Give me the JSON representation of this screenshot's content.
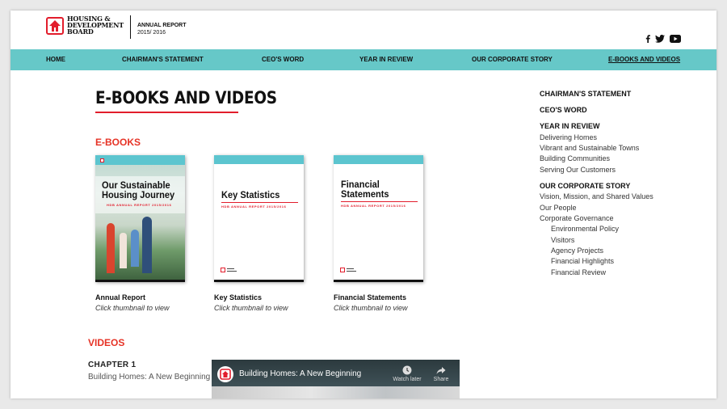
{
  "header": {
    "logo_lines": [
      "HOUSING &",
      "DEVELOPMENT",
      "BOARD"
    ],
    "report_title": "ANNUAL REPORT",
    "report_year": "2015/ 2016",
    "social_icons": [
      "facebook-icon",
      "twitter-icon",
      "youtube-icon"
    ]
  },
  "nav": {
    "items": [
      "HOME",
      "CHAIRMAN'S STATEMENT",
      "CEO'S WORD",
      "YEAR IN REVIEW",
      "OUR CORPORATE STORY",
      "E-BOOKS AND VIDEOS"
    ],
    "active_index": 5
  },
  "main": {
    "title": "E-BOOKS AND VIDEOS",
    "ebooks_heading": "E-BOOKS",
    "books": [
      {
        "cover_title_1": "Our Sustainable",
        "cover_title_2": "Housing Journey",
        "cover_subtitle": "HDB ANNUAL REPORT 2015/2016",
        "caption": "Annual Report",
        "hint": "Click thumbnail to view"
      },
      {
        "cover_title_1": "Key Statistics",
        "cover_subtitle": "HDB ANNUAL REPORT 2015/2016",
        "caption": "Key Statistics",
        "hint": "Click thumbnail to view"
      },
      {
        "cover_title_1": "Financial",
        "cover_title_2": "Statements",
        "cover_subtitle": "HDB ANNUAL REPORT 2015/2016",
        "caption": "Financial Statements",
        "hint": "Click thumbnail to view"
      }
    ],
    "videos_heading": "VIDEOS",
    "chapter": "CHAPTER 1",
    "chapter_title": "Building Homes: A New Beginning",
    "video": {
      "title": "Building Homes: A New Beginning",
      "watch_later": "Watch later",
      "share": "Share"
    }
  },
  "sidebar": {
    "chairman": "CHAIRMAN'S STATEMENT",
    "ceo": "CEO'S WORD",
    "year_in_review": "YEAR IN REVIEW",
    "yir_items": [
      "Delivering Homes",
      "Vibrant and Sustainable Towns",
      "Building Communities",
      "Serving Our Customers"
    ],
    "corporate_story": "OUR CORPORATE STORY",
    "cs_items": [
      "Vision, Mission, and Shared Values",
      "Our People",
      "Corporate Governance"
    ],
    "cg_items": [
      "Environmental Policy",
      "Visitors",
      "Agency Projects",
      "Financial Highlights",
      "Financial Review"
    ]
  },
  "colors": {
    "accent_red": "#e21d2c",
    "nav_teal": "#66c8c8",
    "heading_red": "#e63326"
  }
}
